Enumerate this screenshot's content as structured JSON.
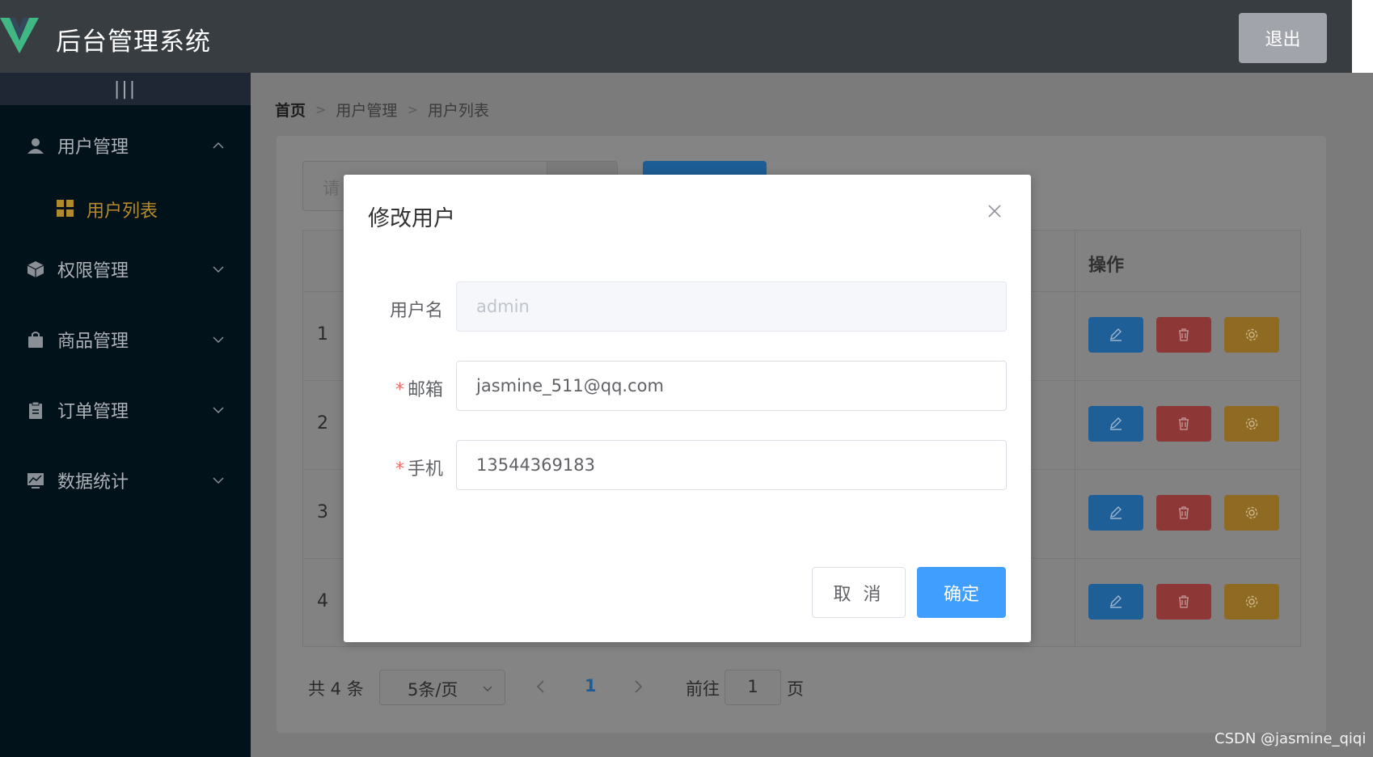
{
  "header": {
    "app_title": "后台管理系统",
    "logout_label": "退出"
  },
  "sidebar": {
    "toggle_label": "|||",
    "menus": [
      {
        "label": "用户管理",
        "icon": "user-icon",
        "expanded": true
      },
      {
        "label": "权限管理",
        "icon": "cube-icon"
      },
      {
        "label": "商品管理",
        "icon": "bag-icon"
      },
      {
        "label": "订单管理",
        "icon": "clipboard-icon"
      },
      {
        "label": "数据统计",
        "icon": "chart-icon"
      }
    ],
    "active_submenu": {
      "label": "用户列表",
      "icon": "grid-icon"
    }
  },
  "breadcrumb": {
    "home": "首页",
    "level1": "用户管理",
    "level2": "用户列表"
  },
  "search": {
    "placeholder": "请"
  },
  "table": {
    "ops_header": "操作",
    "rows": [
      "1",
      "2",
      "3",
      "4"
    ]
  },
  "pagination": {
    "total": "共 4 条",
    "page_size": "5条/页",
    "current_page": "1",
    "goto_prefix": "前往",
    "goto_value": "1",
    "goto_suffix": "页"
  },
  "dialog": {
    "title": "修改用户",
    "username_label": "用户名",
    "username_value": "admin",
    "email_label": "邮箱",
    "email_value": "jasmine_511@qq.com",
    "mobile_label": "手机",
    "mobile_value": "13544369183",
    "cancel_label": "取 消",
    "confirm_label": "确定"
  },
  "watermark": "CSDN @jasmine_qiqi",
  "colors": {
    "primary": "#409eff",
    "danger": "#f56c6c",
    "warning": "#e6a23c",
    "header_bg": "#373d41",
    "sidebar_bg": "#02121a",
    "active_menu": "#ffd04b"
  }
}
